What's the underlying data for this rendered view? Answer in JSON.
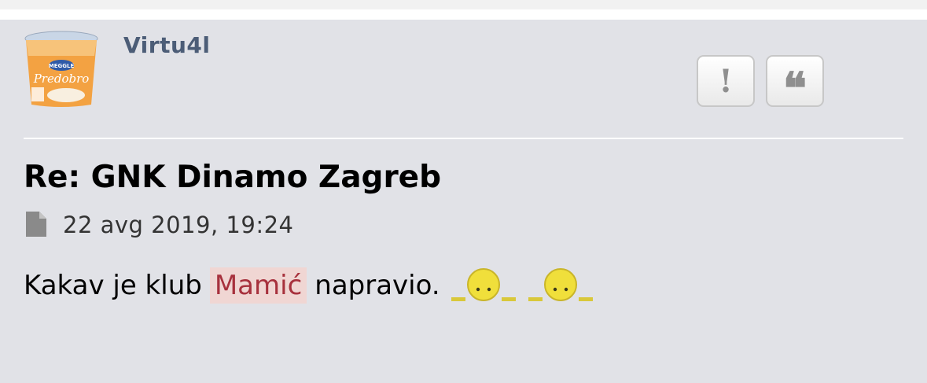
{
  "post": {
    "username": "Virtu4l",
    "avatar_icon": "yogurt-cup-avatar",
    "buttons": {
      "report_label": "!",
      "quote_label": "❝",
      "report_icon": "exclamation-icon",
      "quote_icon": "quote-icon"
    },
    "title": "Re: GNK Dinamo Zagreb",
    "date_icon": "file-icon",
    "date": "22 avg 2019, 19:24",
    "content": {
      "before": "Kakav je klub",
      "highlight": "Mamić",
      "after": "napravio.",
      "smilies": [
        "sad-smiley-icon",
        "sad-smiley-icon"
      ]
    }
  },
  "colors": {
    "post_bg": "#e1e2e7",
    "username": "#4c5d77",
    "highlight_bg": "#f0d6d3",
    "highlight_text": "#a7313d"
  }
}
